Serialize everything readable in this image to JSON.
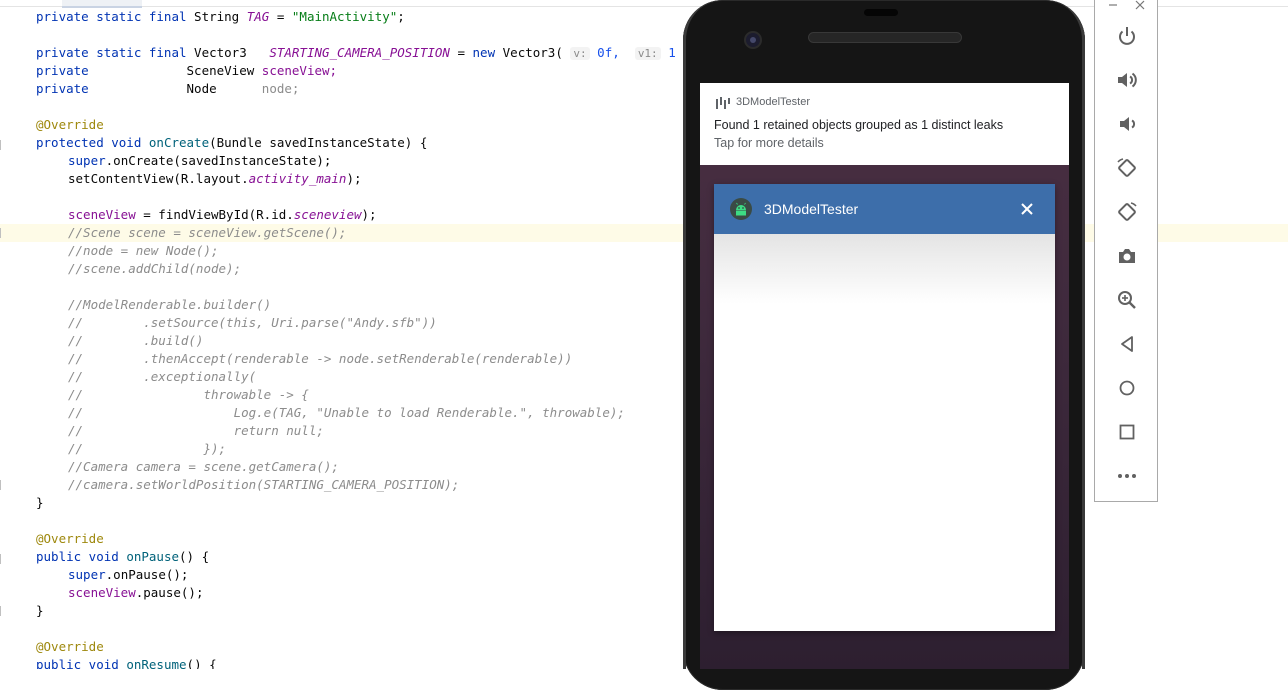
{
  "editor": {
    "lines": {
      "tag": {
        "mod": "private static final",
        "type": "String",
        "name": "TAG",
        "eq": "=",
        "value": "\"MainActivity\"",
        "end": ";"
      },
      "startpos": {
        "mod": "private static final",
        "type": "Vector3",
        "name": "STARTING_CAMERA_POSITION",
        "eq": "=",
        "new": "new",
        "ctor": "Vector3(",
        "hint_v": "v:",
        "v": "0f,",
        "hint_v1": "v1:",
        "v1": "1"
      },
      "sceneview_field": {
        "mod": "private",
        "type": "SceneView",
        "name": "sceneView;"
      },
      "node_field": {
        "mod": "private",
        "type": "Node",
        "name": "node;"
      },
      "override1": "@Override",
      "oncreate_sig": {
        "mod": "protected void",
        "name": "onCreate",
        "rest": "(Bundle savedInstanceState) {"
      },
      "super_oncreate": {
        "kw": "super",
        "rest": ".onCreate(savedInstanceState);"
      },
      "setcontent": {
        "a": "setContentView(R.layout.",
        "b": "activity_main",
        "c": ");"
      },
      "find": {
        "a": "sceneView",
        "b": " = findViewById(R.id.",
        "c": "sceneview",
        "d": ");"
      },
      "c1": "//Scene scene = sceneView.getScene();",
      "c2": "//node = new Node();",
      "c3": "//scene.addChild(node);",
      "c4": "//ModelRenderable.builder()",
      "c5": "//        .setSource(this, Uri.parse(\"Andy.sfb\"))",
      "c6": "//        .build()",
      "c7": "//        .thenAccept(renderable -> node.setRenderable(renderable))",
      "c8": "//        .exceptionally(",
      "c9": "//                throwable -> {",
      "c10": "//                    Log.e(TAG, \"Unable to load Renderable.\", throwable);",
      "c11": "//                    return null;",
      "c12": "//                });",
      "c13": "//Camera camera = scene.getCamera();",
      "c14": "//camera.setWorldPosition(STARTING_CAMERA_POSITION);",
      "close1": "}",
      "override2": "@Override",
      "onpause_sig": {
        "mod": "public void",
        "name": "onPause",
        "rest": "() {"
      },
      "super_onpause": {
        "kw": "super",
        "rest": ".onPause();"
      },
      "pause": {
        "a": "sceneView",
        "b": ".pause();"
      },
      "close2": "}",
      "override3": "@Override",
      "onresume_sig": {
        "mod": "public void",
        "name": "onResume",
        "rest": "() {"
      }
    }
  },
  "phone": {
    "notification": {
      "app_name": "3DModelTester",
      "title": "Found 1 retained objects grouped as 1 distinct leaks",
      "text": "Tap for more details",
      "icon": "leak-canary-icon"
    },
    "app_window": {
      "title": "3DModelTester",
      "icon": "android-icon",
      "close_icon": "close-icon"
    }
  },
  "toolbar": {
    "window_controls": [
      "minimize-icon",
      "close-icon"
    ],
    "buttons": [
      "power-icon",
      "volume-up-icon",
      "volume-down-icon",
      "rotate-left-icon",
      "rotate-right-icon",
      "camera-icon",
      "zoom-icon",
      "back-icon",
      "home-icon",
      "overview-icon",
      "more-icon"
    ]
  },
  "colors": {
    "keyword": "#0033b3",
    "annotation": "#9e880d",
    "field": "#871094",
    "string": "#067d17",
    "comment": "#8c8c8c",
    "appbar": "#3d6eaa"
  }
}
